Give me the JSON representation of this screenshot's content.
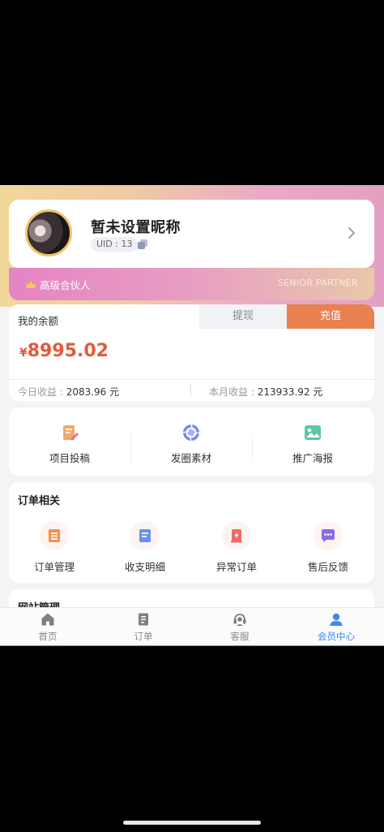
{
  "profile": {
    "nickname": "暂未设置昵称",
    "uid": "UID : 13"
  },
  "tier": {
    "label": "高级合伙人",
    "label_en": "SENIOR PARTNER"
  },
  "balance": {
    "title": "我的余额",
    "withdraw_label": "提现",
    "recharge_label": "充值",
    "currency": "¥",
    "amount": "8995.02",
    "today_label": "今日收益 :",
    "today_value": "2083.96 元",
    "month_label": "本月收益 :",
    "month_value": "213933.92 元"
  },
  "quick_actions": [
    {
      "label": "项目投稿",
      "icon": "edit-document-icon"
    },
    {
      "label": "发圈素材",
      "icon": "aperture-icon"
    },
    {
      "label": "推广海报",
      "icon": "image-icon"
    }
  ],
  "orders": {
    "title": "订单相关",
    "items": [
      {
        "label": "订单管理",
        "icon": "order-list-icon"
      },
      {
        "label": "收支明细",
        "icon": "ledger-icon"
      },
      {
        "label": "异常订单",
        "icon": "alert-order-icon"
      },
      {
        "label": "售后反馈",
        "icon": "chat-icon"
      }
    ]
  },
  "site": {
    "title": "网站管理"
  },
  "tabs": [
    {
      "label": "首页",
      "icon": "home-icon"
    },
    {
      "label": "订单",
      "icon": "order-icon"
    },
    {
      "label": "客服",
      "icon": "headset-icon"
    },
    {
      "label": "会员中心",
      "icon": "user-icon",
      "active": true
    }
  ],
  "colors": {
    "accent_orange": "#e8804f",
    "amount_red": "#e35a3a",
    "active_tab_blue": "#3e89f5",
    "tier_pink": "#e584c4",
    "avatar_border_gold": "#f0c46a"
  }
}
